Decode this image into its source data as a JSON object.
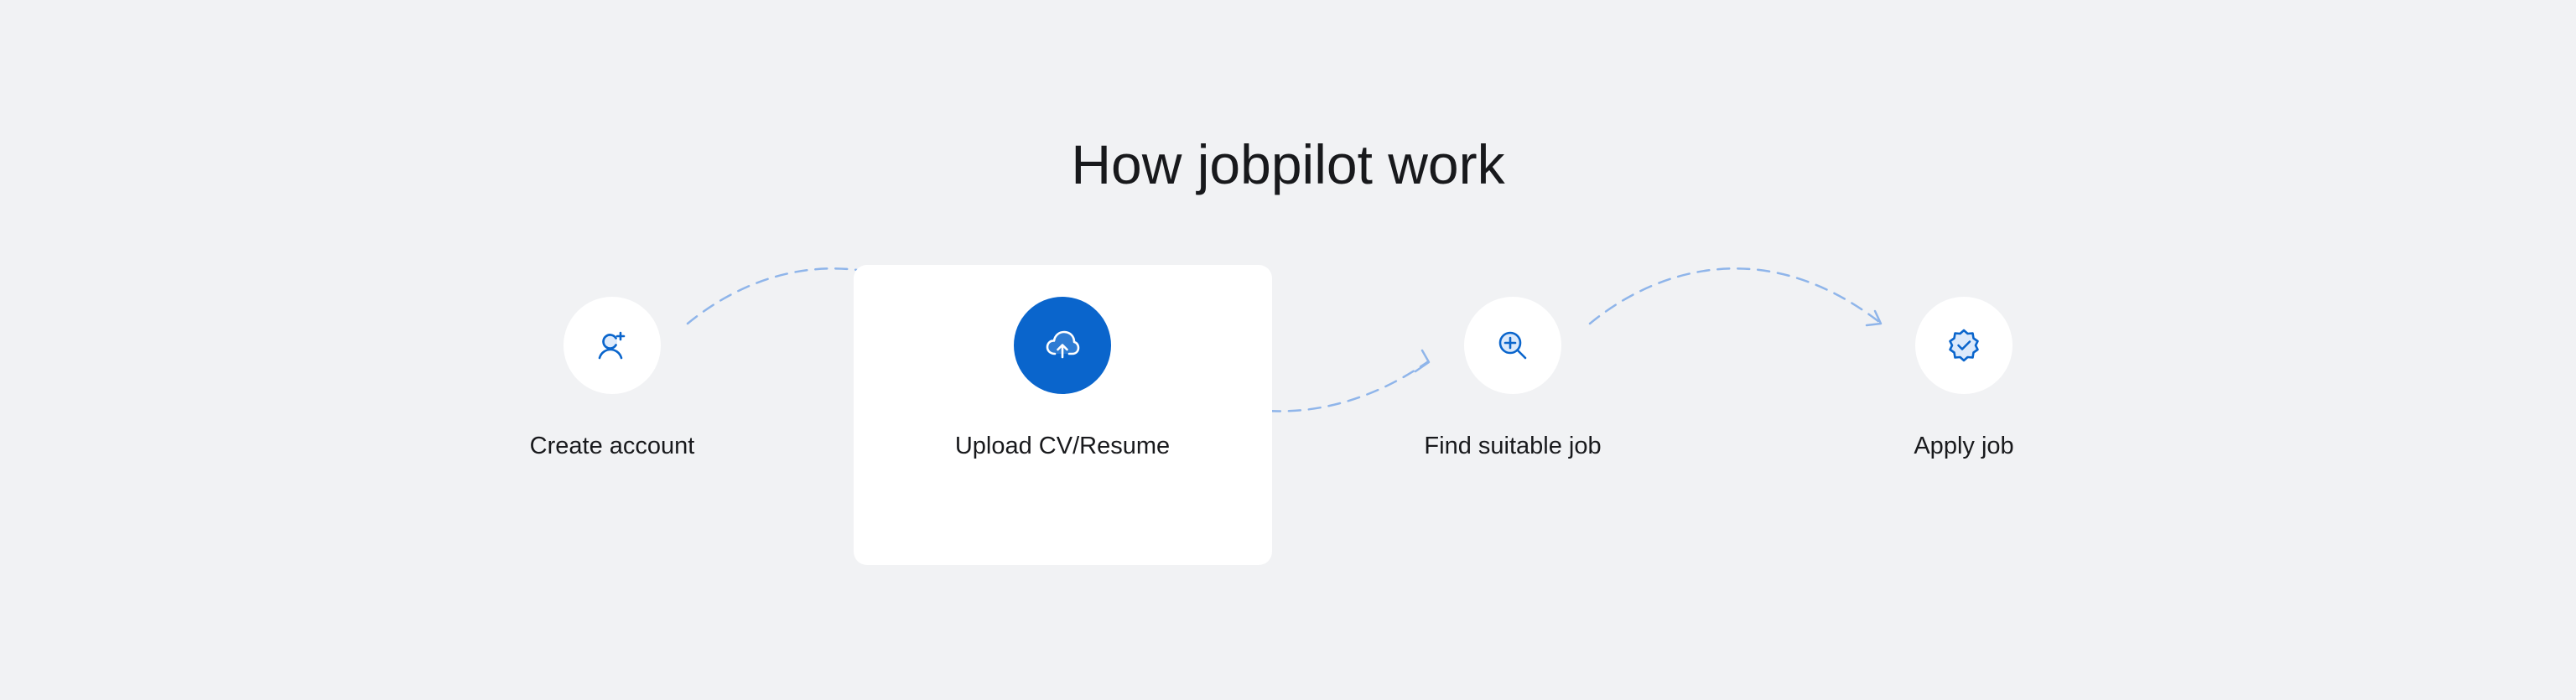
{
  "section": {
    "title": "How jobpilot work"
  },
  "steps": [
    {
      "label": "Create account",
      "icon": "user-plus-icon",
      "active": false
    },
    {
      "label": "Upload CV/Resume",
      "icon": "cloud-upload-icon",
      "active": true
    },
    {
      "label": "Find suitable job",
      "icon": "magnifying-glass-plus-icon",
      "active": false
    },
    {
      "label": "Apply job",
      "icon": "verified-badge-icon",
      "active": false
    }
  ],
  "colors": {
    "background": "#f1f2f4",
    "primary": "#0a65cc",
    "text": "#18191c",
    "connector": "#99c2ff"
  }
}
